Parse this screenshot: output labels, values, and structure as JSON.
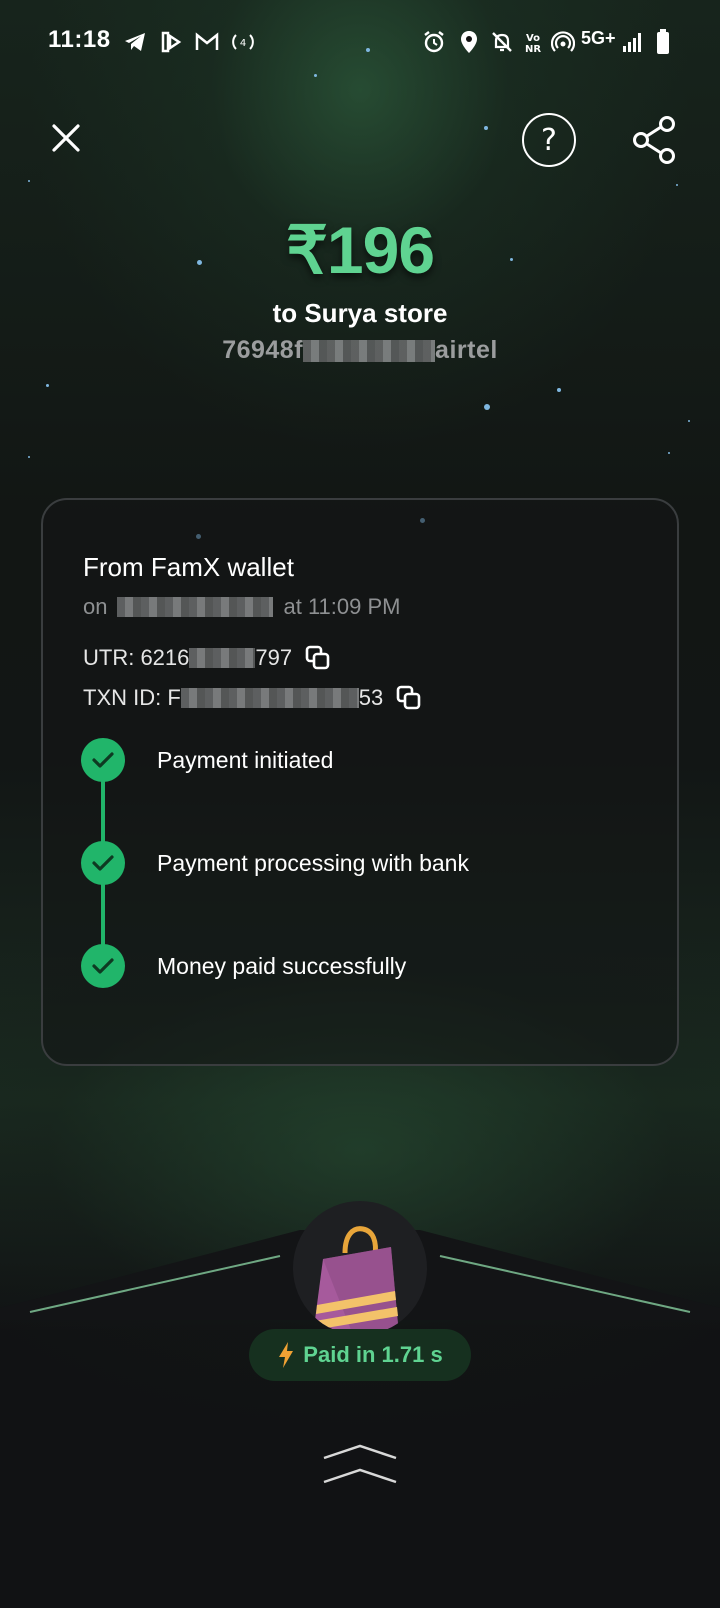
{
  "status_bar": {
    "time": "11:18",
    "network": "5G+",
    "icons": [
      "telegram-icon",
      "app-icon",
      "gmail-icon",
      "hotspot-icon",
      "alarm-icon",
      "location-icon",
      "mute-icon",
      "vonr-icon",
      "wifi-calling-icon",
      "signal-icon",
      "battery-icon"
    ]
  },
  "nav": {
    "close_icon": "close-icon",
    "help_icon": "help-icon",
    "share_icon": "share-icon"
  },
  "payment": {
    "amount": "₹196",
    "payee": "to Surya store",
    "vpa_prefix": "76948f",
    "vpa_suffix": "airtel"
  },
  "card": {
    "source": "From FamX wallet",
    "date_prefix": "on",
    "date_suffix": "at 11:09 PM",
    "utr_prefix": "UTR: 6216",
    "utr_suffix": "797",
    "txn_prefix": "TXN ID: F",
    "txn_suffix": "53",
    "steps": [
      {
        "label": "Payment initiated"
      },
      {
        "label": "Payment processing with bank"
      },
      {
        "label": "Money paid successfully"
      }
    ]
  },
  "footer": {
    "paid_label": "Paid in 1.71 s",
    "accent_color": "#5fd391"
  }
}
